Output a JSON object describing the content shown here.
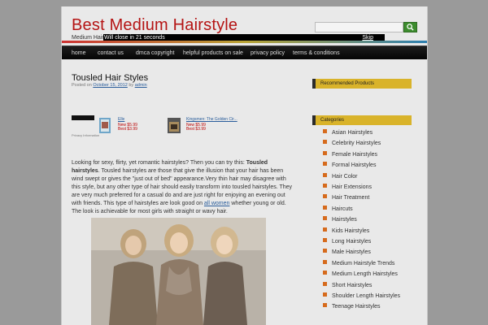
{
  "site": {
    "title": "Best Medium Hairstyle",
    "tagline": "Medium Hairst",
    "countdown": "Will close in 21 seconds",
    "skip": "Skip"
  },
  "nav": [
    {
      "label": "home"
    },
    {
      "label": "contact us"
    },
    {
      "label": "dmca copyright"
    },
    {
      "label": "helpful products on sale"
    },
    {
      "label": "privacy policy"
    },
    {
      "label": "terms & conditions"
    }
  ],
  "post": {
    "title": "Tousled Hair Styles",
    "posted_on": "Posted on",
    "date": "October 15, 2012",
    "by": "by",
    "author": "admin",
    "paragraph_pre": "Looking for sexy, flirty, yet romantic hairstyles? Then you can try this: ",
    "paragraph_bold": "Tousled hairstyles",
    "paragraph_mid": ". Tousled hairstyles are those that give the illusion that your hair has been wind swept or gives the \"just out of bed\" appearance.Very thin hair may disagree with this style, but any other type of hair should easily transform into tousled hairstyles. They are very much preferred for a casual do and are just right for enjoying an evening out with friends. This type of hairstyles are look good on ",
    "paragraph_link": "all women",
    "paragraph_post": " whether young or old. The look is achievable for most girls with straight or wavy hair."
  },
  "ads": {
    "product1": {
      "title": "Elle",
      "new_label": "New $5.99",
      "best_label": "Best $3.99"
    },
    "product2": {
      "title": "Kingsmen: The Golden Cir...",
      "new_label": "New $5.99",
      "best_label": "Best $3.99"
    },
    "privacy": "Privacy Information"
  },
  "sidebar": {
    "recommended": "Recommended Products",
    "categories_title": "Categories",
    "categories": [
      "Asian Hairstyles",
      "Celebrity Hairstyles",
      "Female Hairstyles",
      "Formal Hairstyles",
      "Hair Color",
      "Hair Extensions",
      "Hair Treatment",
      "Haircuts",
      "Hairstyles",
      "Kids Hairstyles",
      "Long Hairstyles",
      "Male Hairstyles",
      "Medium Hairstyle Trends",
      "Medium Length Hairstyles",
      "Short Hairstyles",
      "Shoulder Length Hairstyles",
      "Teenage Hairstyles"
    ]
  },
  "colors": {
    "title": "#b51414",
    "nav_bg": "#0a0a0a",
    "widget_head": "#d9b32a",
    "bullet": "#d66b1d",
    "search_button": "#3c8c2d"
  }
}
